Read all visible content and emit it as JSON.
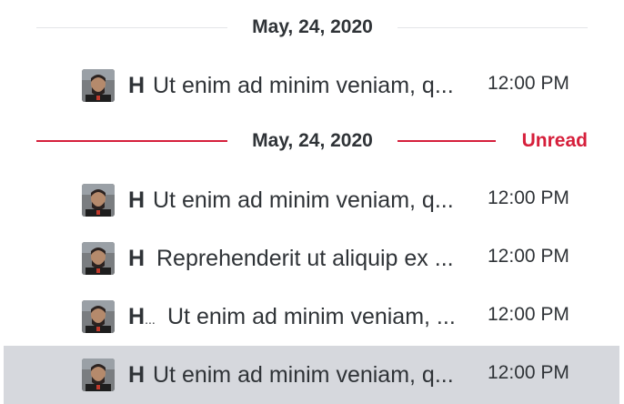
{
  "dividers": [
    {
      "date": "May, 24, 2020",
      "unread_label": ""
    },
    {
      "date": "May, 24, 2020",
      "unread_label": "Unread"
    }
  ],
  "messages": [
    {
      "author": "H",
      "text": "Ut enim ad minim veniam, q...",
      "time": "12:00 PM",
      "selected": false
    },
    {
      "author": "H",
      "text": "Ut enim ad minim veniam, q...",
      "time": "12:00 PM",
      "selected": false
    },
    {
      "author": "H",
      "text": "Reprehenderit ut aliquip ex ...",
      "time": "12:00 PM",
      "selected": false
    },
    {
      "author": "H",
      "author_suffix": "...",
      "text": "Ut enim ad minim veniam, ...",
      "time": "12:00 PM",
      "selected": false
    },
    {
      "author": "H",
      "text": "Ut enim ad minim veniam, q...",
      "time": "12:00 PM",
      "selected": true
    }
  ],
  "colors": {
    "unread_accent": "#d61f3b",
    "selected_row_bg": "#d6d8dd",
    "text": "#2f3337",
    "divider_line": "#e3e5e8"
  }
}
